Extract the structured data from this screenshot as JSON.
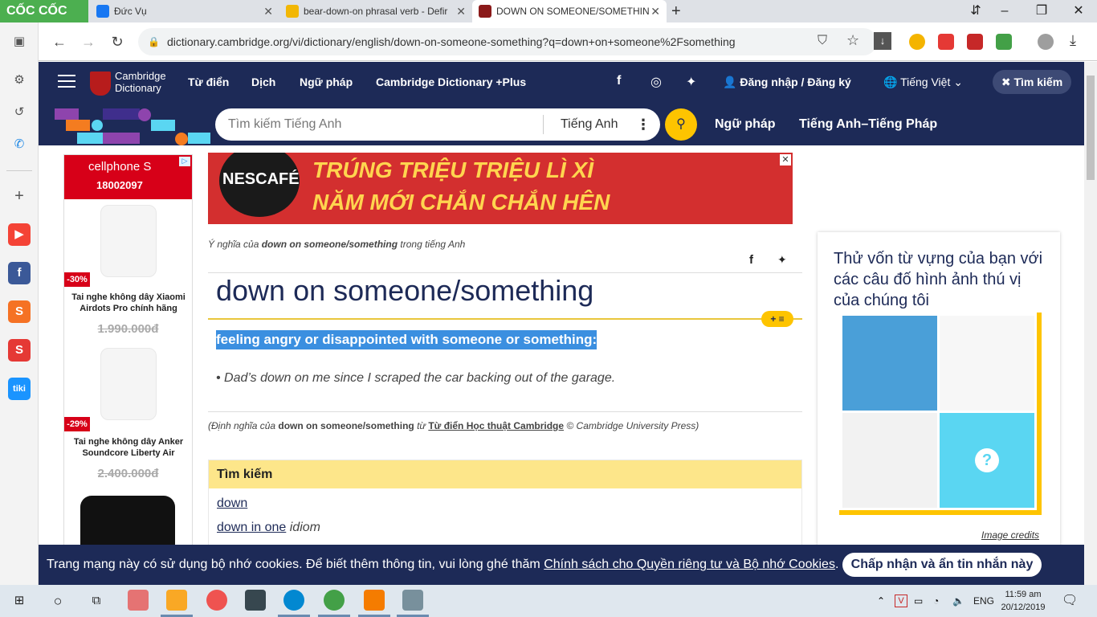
{
  "browser": {
    "brand": "CỐC CỐC",
    "tabs": [
      {
        "title": "Đức Vụ"
      },
      {
        "title": "bear-down-on phrasal verb - Defir"
      },
      {
        "title": "DOWN ON SOMEONE/SOMETHIN"
      }
    ],
    "url": "dictionary.cambridge.org/vi/dictionary/english/down-on-someone-something?q=down+on+someone%2Fsomething"
  },
  "header": {
    "logo_line1": "Cambridge",
    "logo_line2": "Dictionary",
    "nav": [
      "Từ điển",
      "Dịch",
      "Ngữ pháp",
      "Cambridge Dictionary +Plus"
    ],
    "login": "Đăng nhập / Đăng ký",
    "language": "Tiếng Việt",
    "search_toggle": "Tìm kiếm"
  },
  "search": {
    "placeholder": "Tìm kiếm Tiếng Anh",
    "dictionary": "Tiếng Anh",
    "links": [
      "Ngữ pháp",
      "Tiếng Anh–Tiếng Pháp"
    ]
  },
  "left_ad": {
    "brand": "cellphone S",
    "phone": "18002097",
    "products": [
      {
        "discount": "-30%",
        "name": "Tai nghe không dây Xiaomi Airdots Pro chính hãng",
        "price": "1.990.000đ"
      },
      {
        "discount": "-29%",
        "name": "Tai nghe không dây Anker Soundcore Liberty Air",
        "price": "2.400.000đ"
      }
    ]
  },
  "banner": {
    "brand": "NESCAFÉ",
    "line1": "TRÚNG TRIỆU TRIỆU LÌ XÌ",
    "line2": "NĂM MỚI CHẮN CHẮN HÊN"
  },
  "entry": {
    "breadcrumb_prefix": "Ý nghĩa của ",
    "breadcrumb_word": "down on someone/something",
    "breadcrumb_suffix": " trong tiếng Anh",
    "headword": "down on someone/something",
    "definition": "feeling angry or disappointed with someone or something:",
    "example": "Dad’s down on me since I scraped the car backing out of the garage.",
    "source_prefix": "(Định nghĩa của ",
    "source_word": "down on someone/something",
    "source_mid": " từ ",
    "source_dict": "Từ điển Học thuật Cambridge",
    "source_suffix": " © Cambridge University Press)"
  },
  "search_box": {
    "title": "Tìm kiếm",
    "results": [
      {
        "text": "down",
        "tag": ""
      },
      {
        "text": "down in one",
        "tag": "idiom"
      }
    ]
  },
  "quiz": {
    "title": "Thử vốn từ vựng của bạn với các câu đố hình ảnh thú vị của chúng tôi",
    "credits": "Image credits"
  },
  "cookie": {
    "text": "Trang mạng này có sử dụng bộ nhớ cookies. Để biết thêm thông tin, vui lòng ghé thăm ",
    "link": "Chính sách cho Quyền riêng tư và Bộ nhớ Cookies",
    "button": "Chấp nhận và ẩn tin nhắn này"
  },
  "taskbar": {
    "lang": "ENG",
    "time": "11:59 am",
    "date": "20/12/2019"
  }
}
